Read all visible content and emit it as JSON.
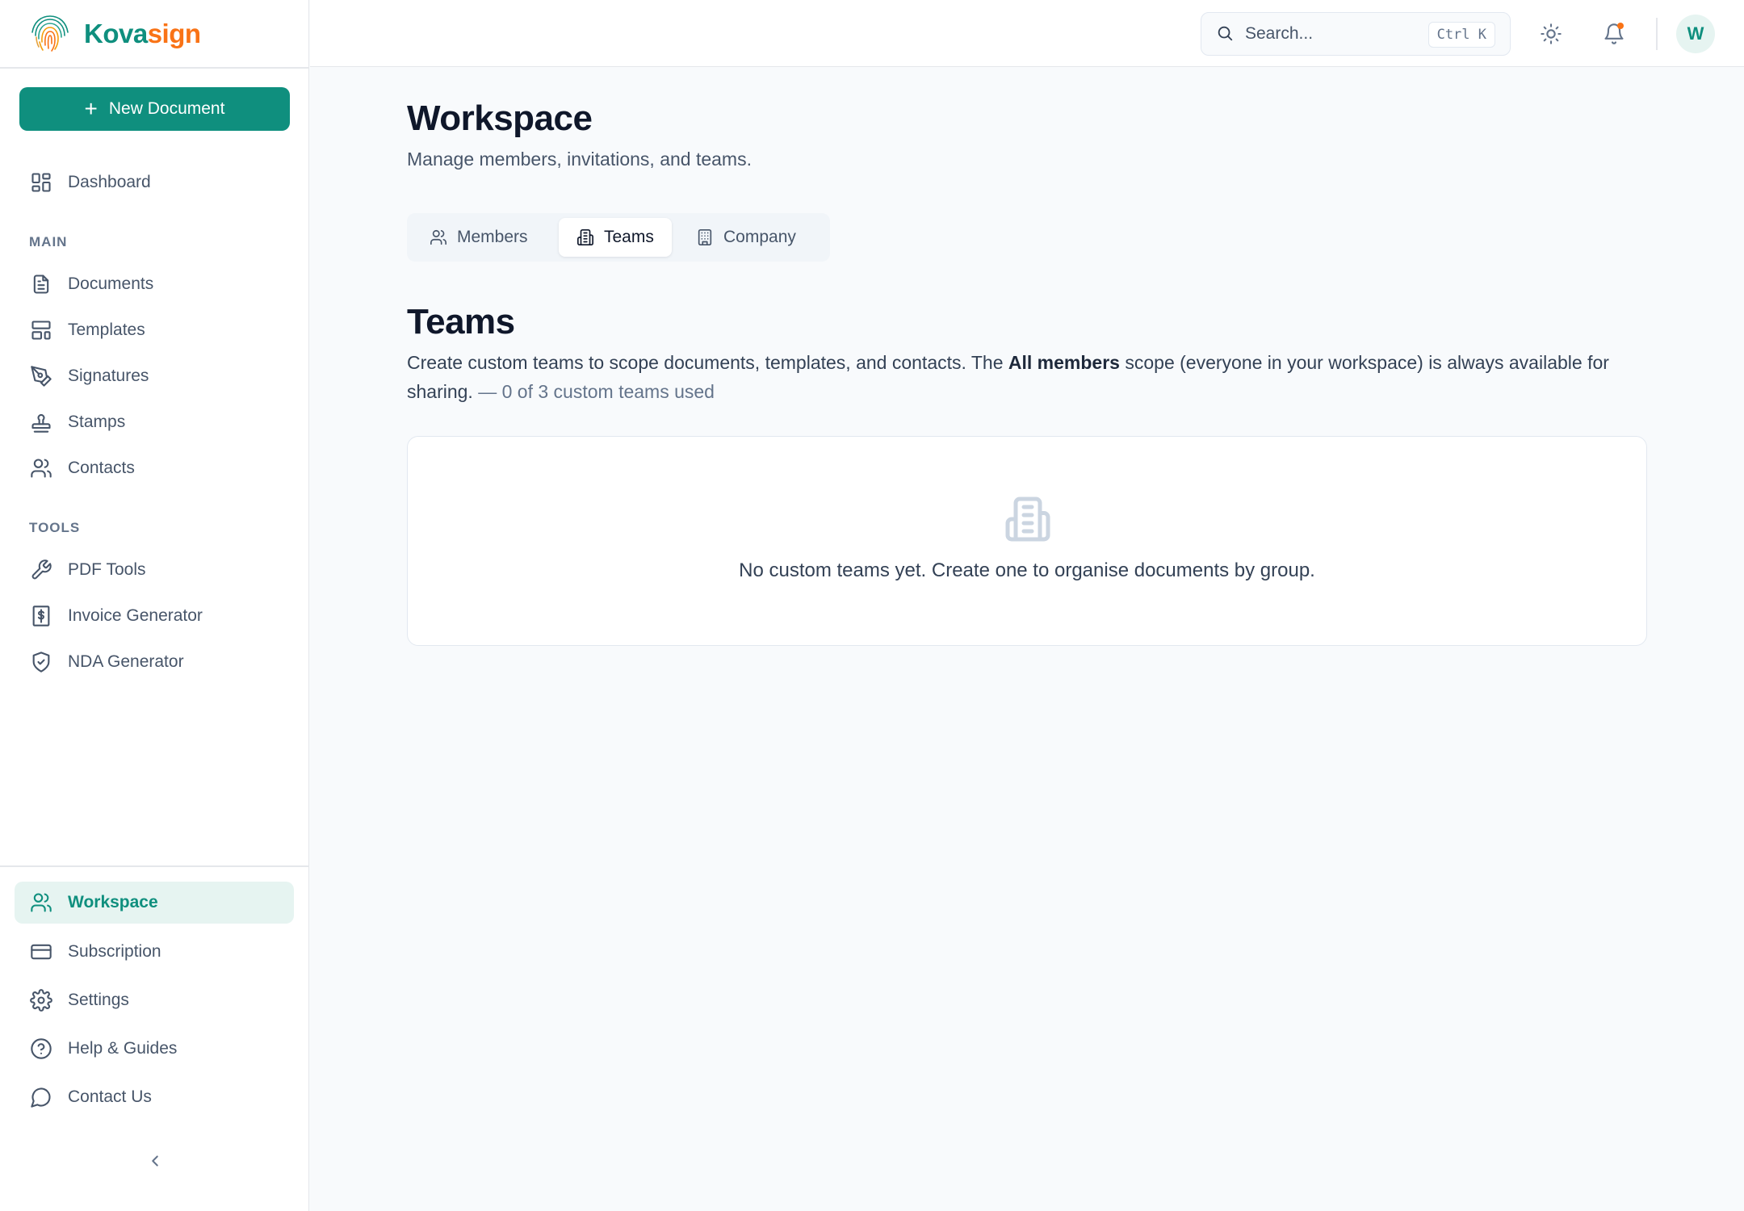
{
  "app": {
    "brand_part1": "Kova",
    "brand_part2": "sign",
    "colors": {
      "accent": "#0f8f7e",
      "brand_orange": "#f97316",
      "active_bg": "#e6f4f1"
    }
  },
  "sidebar": {
    "new_document_label": "New Document",
    "dashboard": {
      "label": "Dashboard",
      "icon": "dashboard-icon"
    },
    "main_section_label": "MAIN",
    "main_items": [
      {
        "label": "Documents",
        "icon": "document-icon"
      },
      {
        "label": "Templates",
        "icon": "template-icon"
      },
      {
        "label": "Signatures",
        "icon": "pen-icon"
      },
      {
        "label": "Stamps",
        "icon": "stamp-icon"
      },
      {
        "label": "Contacts",
        "icon": "users-icon"
      }
    ],
    "tools_section_label": "TOOLS",
    "tools_items": [
      {
        "label": "PDF Tools",
        "icon": "wrench-icon"
      },
      {
        "label": "Invoice Generator",
        "icon": "receipt-icon"
      },
      {
        "label": "NDA Generator",
        "icon": "shield-check-icon"
      }
    ],
    "bottom_items": [
      {
        "label": "Workspace",
        "icon": "users-icon",
        "active": true
      },
      {
        "label": "Subscription",
        "icon": "credit-card-icon"
      },
      {
        "label": "Settings",
        "icon": "gear-icon"
      },
      {
        "label": "Help & Guides",
        "icon": "help-circle-icon"
      },
      {
        "label": "Contact Us",
        "icon": "chat-bubble-icon"
      }
    ]
  },
  "topbar": {
    "search_placeholder": "Search...",
    "search_shortcut": "Ctrl K",
    "avatar_initial": "W"
  },
  "main": {
    "title": "Workspace",
    "subtitle": "Manage members, invitations, and teams.",
    "tabs": [
      {
        "label": "Members",
        "icon": "users-icon"
      },
      {
        "label": "Teams",
        "icon": "building-icon",
        "active": true
      },
      {
        "label": "Company",
        "icon": "office-icon"
      }
    ],
    "section_title": "Teams",
    "section_desc_before": "Create custom teams to scope documents, templates, and contacts. The ",
    "section_desc_bold": "All members",
    "section_desc_after": " scope (everyone in your workspace) is always available for sharing.",
    "section_quota": " — 0 of 3 custom teams used",
    "empty_text": "No custom teams yet. Create one to organise documents by group."
  }
}
